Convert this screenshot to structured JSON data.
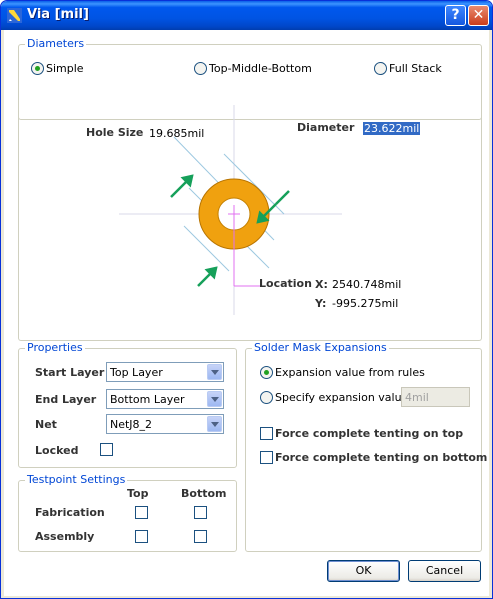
{
  "window": {
    "title": "Via [mil]"
  },
  "diameters": {
    "title": "Diameters",
    "options": [
      {
        "label": "Simple",
        "selected": true
      },
      {
        "label": "Top-Middle-Bottom",
        "selected": false
      },
      {
        "label": "Full Stack",
        "selected": false
      }
    ]
  },
  "diagram": {
    "hole_size_label": "Hole Size",
    "hole_size_value": "19.685mil",
    "diameter_label": "Diameter",
    "diameter_value": "23.622mil",
    "location_label": "Location",
    "x_label": "X:",
    "x_value": "2540.748mil",
    "y_label": "Y:",
    "y_value": "-995.275mil"
  },
  "properties": {
    "title": "Properties",
    "start_layer_label": "Start Layer",
    "start_layer_value": "Top Layer",
    "end_layer_label": "End Layer",
    "end_layer_value": "Bottom Layer",
    "net_label": "Net",
    "net_value": "NetJ8_2",
    "locked_label": "Locked",
    "locked_checked": false
  },
  "testpoint": {
    "title": "Testpoint Settings",
    "col_top": "Top",
    "col_bottom": "Bottom",
    "rows": [
      {
        "label": "Fabrication",
        "top": false,
        "bottom": false
      },
      {
        "label": "Assembly",
        "top": false,
        "bottom": false
      }
    ]
  },
  "solder_mask": {
    "title": "Solder Mask Expansions",
    "from_rules_label": "Expansion value from rules",
    "from_rules_selected": true,
    "specify_label": "Specify expansion value",
    "specify_selected": false,
    "specify_value": "4mil",
    "tent_top_label": "Force complete tenting on top",
    "tent_top_checked": false,
    "tent_bottom_label": "Force complete tenting on bottom",
    "tent_bottom_checked": false
  },
  "buttons": {
    "ok": "OK",
    "cancel": "Cancel"
  },
  "colors": {
    "accent": "#0046d5",
    "arrow": "#16a05a",
    "via_ring": "#f0a10f",
    "hole": "#ffffff",
    "guide": "#e070f0"
  }
}
